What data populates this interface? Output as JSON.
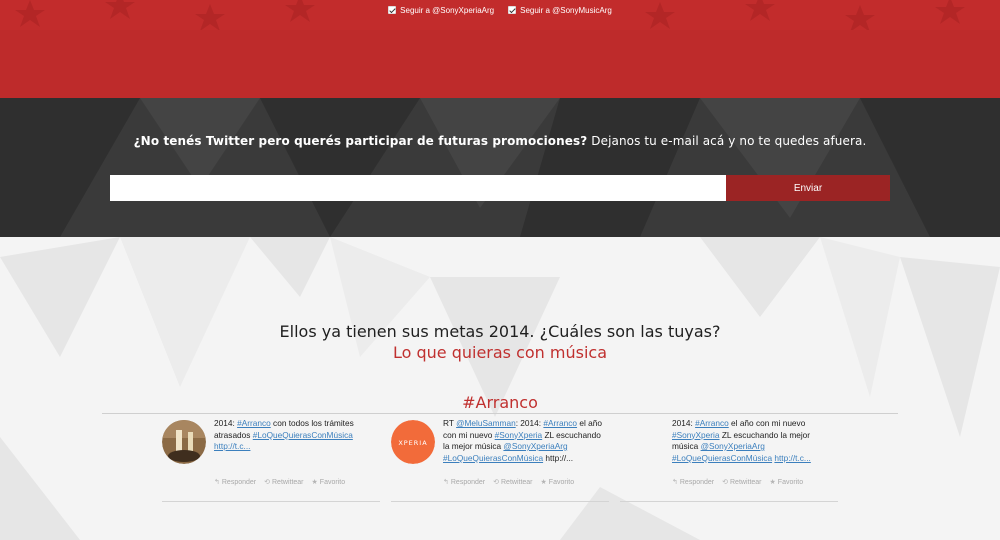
{
  "follow": [
    {
      "label": "Seguir a @SonyXperiaArg",
      "checked": true
    },
    {
      "label": "Seguir a @SonyMusicArg",
      "checked": true
    }
  ],
  "signup": {
    "question_bold": "¿No tenés Twitter pero querés participar de futuras promociones?",
    "question_rest": " Dejanos tu e-mail acá y no te quedes afuera.",
    "email_value": "",
    "submit_label": "Enviar"
  },
  "intro": {
    "headline": "Ellos ya tienen sus metas 2014. ¿Cuáles son las tuyas?",
    "subline": "Lo que quieras con música"
  },
  "feed": {
    "hashtag_title": "#Arranco",
    "tweets": [
      {
        "avatar": "photo-avatar",
        "segments": [
          {
            "t": "2014: ",
            "link": false
          },
          {
            "t": "#Arranco",
            "link": true
          },
          {
            "t": " con todos los trámites atrasados ",
            "link": false
          },
          {
            "t": "#LoQueQuierasConMúsica",
            "link": true
          },
          {
            "t": " ",
            "link": false
          },
          {
            "t": "http://t.c...",
            "link": true
          }
        ]
      },
      {
        "avatar": "xperia-logo-avatar",
        "avatar_text": "XPERIA",
        "segments": [
          {
            "t": "RT ",
            "link": false
          },
          {
            "t": "@MeluSamman",
            "link": true
          },
          {
            "t": ": 2014: ",
            "link": false
          },
          {
            "t": "#Arranco",
            "link": true
          },
          {
            "t": " el año con mi nuevo ",
            "link": false
          },
          {
            "t": "#SonyXperia",
            "link": true
          },
          {
            "t": " ZL escuchando la mejor música ",
            "link": false
          },
          {
            "t": "@SonyXperiaArg",
            "link": true
          },
          {
            "t": " ",
            "link": false
          },
          {
            "t": "#LoQueQuierasConMúsica",
            "link": true
          },
          {
            "t": " http://...",
            "link": false
          }
        ]
      },
      {
        "avatar": "none",
        "segments": [
          {
            "t": "2014: ",
            "link": false
          },
          {
            "t": "#Arranco",
            "link": true
          },
          {
            "t": " el año con mi nuevo ",
            "link": false
          },
          {
            "t": "#SonyXperia",
            "link": true
          },
          {
            "t": " ZL escuchando la mejor música ",
            "link": false
          },
          {
            "t": "@SonyXperiaArg",
            "link": true
          },
          {
            "t": " ",
            "link": false
          },
          {
            "t": "#LoQueQuierasConMúsica",
            "link": true
          },
          {
            "t": " ",
            "link": false
          },
          {
            "t": "http://t.c...",
            "link": true
          }
        ]
      }
    ],
    "actions": [
      {
        "icon": "reply-icon",
        "label": "Responder"
      },
      {
        "icon": "retweet-icon",
        "label": "Retwittear"
      },
      {
        "icon": "star-icon",
        "label": "Favorito"
      }
    ]
  },
  "colors": {
    "brand_red": "#c22c2c",
    "accent_red": "#c0302f",
    "button_red": "#9b2424",
    "dark_band": "#3a3a3a",
    "link_blue": "#3b7fbd"
  }
}
